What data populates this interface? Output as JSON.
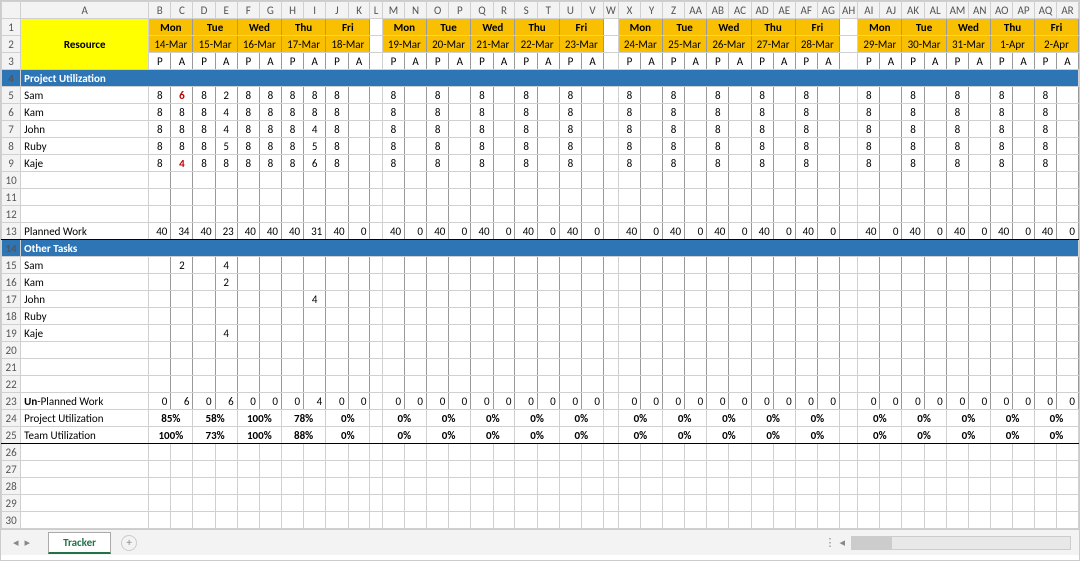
{
  "sheet_tab": "Tracker",
  "col_letters": [
    "",
    "A",
    "B",
    "C",
    "D",
    "E",
    "F",
    "G",
    "H",
    "I",
    "J",
    "K",
    "L",
    "M",
    "N",
    "O",
    "P",
    "Q",
    "R",
    "S",
    "T",
    "U",
    "V",
    "W",
    "X",
    "Y",
    "Z",
    "AA",
    "AB",
    "AC",
    "AD",
    "AE",
    "AF",
    "AG",
    "AH",
    "AI",
    "AJ",
    "AK",
    "AL",
    "AM",
    "AN",
    "AO",
    "AP",
    "AQ",
    "AR"
  ],
  "resource_label": "Resource",
  "section1": "Project Utilization",
  "section2": "Other Tasks",
  "row_unplanned": "Un-Planned Work",
  "row_plannedwork": "Planned Work",
  "row_projutil": "Project Utilization",
  "row_teamutil": "Team Utilization",
  "names": [
    "Sam",
    "Kam",
    "John",
    "Ruby",
    "Kaje"
  ],
  "pa": [
    "P",
    "A"
  ],
  "weeks": [
    {
      "days": [
        "Mon",
        "Tue",
        "Wed",
        "Thu",
        "Fri"
      ],
      "dates": [
        "14-Mar",
        "15-Mar",
        "16-Mar",
        "17-Mar",
        "18-Mar"
      ]
    },
    {
      "days": [
        "Mon",
        "Tue",
        "Wed",
        "Thu",
        "Fri"
      ],
      "dates": [
        "19-Mar",
        "20-Mar",
        "21-Mar",
        "22-Mar",
        "23-Mar"
      ]
    },
    {
      "days": [
        "Mon",
        "Tue",
        "Wed",
        "Thu",
        "Fri"
      ],
      "dates": [
        "24-Mar",
        "25-Mar",
        "26-Mar",
        "27-Mar",
        "28-Mar"
      ]
    },
    {
      "days": [
        "Mon",
        "Tue",
        "Wed",
        "Thu",
        "Fri"
      ],
      "dates": [
        "29-Mar",
        "30-Mar",
        "31-Mar",
        "1-Apr",
        "2-Apr"
      ]
    }
  ],
  "planned": {
    "Sam": [
      [
        "8",
        "6"
      ],
      [
        "8",
        "2"
      ],
      [
        "8",
        "8"
      ],
      [
        "8",
        "8"
      ],
      [
        "8",
        ""
      ]
    ],
    "Kam": [
      [
        "8",
        "8"
      ],
      [
        "8",
        "4"
      ],
      [
        "8",
        "8"
      ],
      [
        "8",
        "8"
      ],
      [
        "8",
        ""
      ]
    ],
    "John": [
      [
        "8",
        "8"
      ],
      [
        "8",
        "4"
      ],
      [
        "8",
        "8"
      ],
      [
        "8",
        "4"
      ],
      [
        "8",
        ""
      ]
    ],
    "Ruby": [
      [
        "8",
        "8"
      ],
      [
        "8",
        "5"
      ],
      [
        "8",
        "8"
      ],
      [
        "8",
        "5"
      ],
      [
        "8",
        ""
      ]
    ],
    "Kaje": [
      [
        "8",
        "4"
      ],
      [
        "8",
        "8"
      ],
      [
        "8",
        "8"
      ],
      [
        "8",
        "6"
      ],
      [
        "8",
        ""
      ]
    ]
  },
  "planned_rest_P": "8",
  "planned_work_w1": [
    "40",
    "34",
    "40",
    "23",
    "40",
    "40",
    "40",
    "31",
    "40",
    "0"
  ],
  "planned_work_rest": [
    "40",
    "0",
    "40",
    "0",
    "40",
    "0",
    "40",
    "0",
    "40",
    "0"
  ],
  "other": {
    "Sam": [
      "",
      "2",
      "",
      "4",
      "",
      "",
      "",
      "",
      "",
      ""
    ],
    "Kam": [
      "",
      "",
      "",
      "2",
      "",
      "",
      "",
      "",
      "",
      ""
    ],
    "John": [
      "",
      "",
      "",
      "",
      "",
      "",
      "",
      "4",
      "",
      ""
    ],
    "Ruby": [
      "",
      "",
      "",
      "",
      "",
      "",
      "",
      "",
      "",
      ""
    ],
    "Kaje": [
      "",
      "",
      "",
      "4",
      "",
      "",
      "",
      "",
      "",
      ""
    ]
  },
  "unplanned_w1": [
    "0",
    "6",
    "0",
    "6",
    "0",
    "0",
    "0",
    "4",
    "0",
    "0"
  ],
  "unplanned_rest": [
    "0",
    "0",
    "0",
    "0",
    "0",
    "0",
    "0",
    "0",
    "0",
    "0"
  ],
  "proj_util_w1": [
    "85%",
    "58%",
    "100%",
    "78%",
    "0%"
  ],
  "team_util_w1": [
    "100%",
    "73%",
    "100%",
    "88%",
    "0%"
  ],
  "util_rest": [
    "0%",
    "0%",
    "0%",
    "0%",
    "0%"
  ]
}
